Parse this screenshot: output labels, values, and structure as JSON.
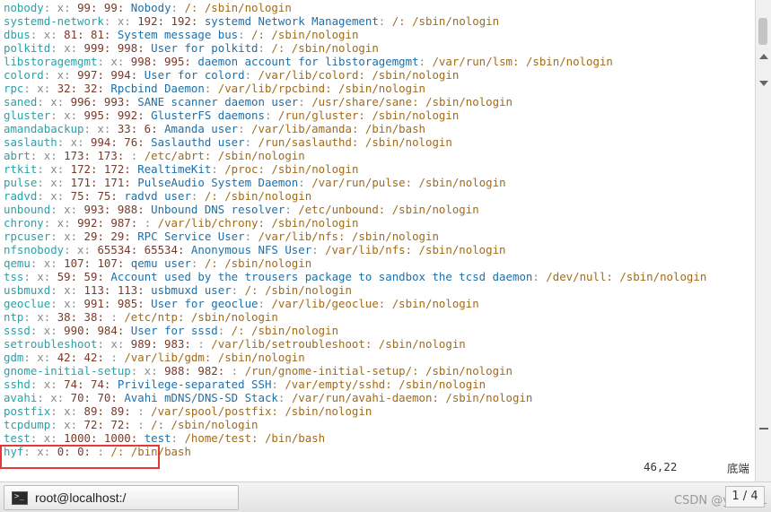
{
  "terminal": {
    "lines": [
      [
        [
          "user",
          "nobody"
        ],
        [
          "sep",
          ": x: "
        ],
        [
          "num",
          "99: 99: "
        ],
        [
          "desc",
          "Nobody"
        ],
        [
          "sep",
          ": "
        ],
        [
          "path",
          "/: /sbin/nologin"
        ]
      ],
      [
        [
          "user",
          "systemd-network"
        ],
        [
          "sep",
          ": x: "
        ],
        [
          "num",
          "192: 192: "
        ],
        [
          "desc",
          "systemd Network Management"
        ],
        [
          "sep",
          ": "
        ],
        [
          "path",
          "/: /sbin/nologin"
        ]
      ],
      [
        [
          "user",
          "dbus"
        ],
        [
          "sep",
          ": x: "
        ],
        [
          "num",
          "81: 81: "
        ],
        [
          "desc",
          "System message bus"
        ],
        [
          "sep",
          ": "
        ],
        [
          "path",
          "/: /sbin/nologin"
        ]
      ],
      [
        [
          "user",
          "polkitd"
        ],
        [
          "sep",
          ": x: "
        ],
        [
          "num",
          "999: 998: "
        ],
        [
          "desc",
          "User for polkitd"
        ],
        [
          "sep",
          ": "
        ],
        [
          "path",
          "/: /sbin/nologin"
        ]
      ],
      [
        [
          "user",
          "libstoragemgmt"
        ],
        [
          "sep",
          ": x: "
        ],
        [
          "num",
          "998: 995: "
        ],
        [
          "desc",
          "daemon account for libstoragemgmt"
        ],
        [
          "sep",
          ": "
        ],
        [
          "path",
          "/var/run/lsm: /sbin/nologin"
        ]
      ],
      [
        [
          "user",
          "colord"
        ],
        [
          "sep",
          ": x: "
        ],
        [
          "num",
          "997: 994: "
        ],
        [
          "desc",
          "User for colord"
        ],
        [
          "sep",
          ": "
        ],
        [
          "path",
          "/var/lib/colord: /sbin/nologin"
        ]
      ],
      [
        [
          "user",
          "rpc"
        ],
        [
          "sep",
          ": x: "
        ],
        [
          "num",
          "32: 32: "
        ],
        [
          "desc",
          "Rpcbind Daemon"
        ],
        [
          "sep",
          ": "
        ],
        [
          "path",
          "/var/lib/rpcbind: /sbin/nologin"
        ]
      ],
      [
        [
          "user",
          "saned"
        ],
        [
          "sep",
          ": x: "
        ],
        [
          "num",
          "996: 993: "
        ],
        [
          "desc",
          "SANE scanner daemon user"
        ],
        [
          "sep",
          ": "
        ],
        [
          "path",
          "/usr/share/sane: /sbin/nologin"
        ]
      ],
      [
        [
          "user",
          "gluster"
        ],
        [
          "sep",
          ": x: "
        ],
        [
          "num",
          "995: 992: "
        ],
        [
          "desc",
          "GlusterFS daemons"
        ],
        [
          "sep",
          ": "
        ],
        [
          "path",
          "/run/gluster: /sbin/nologin"
        ]
      ],
      [
        [
          "user",
          "amandabackup"
        ],
        [
          "sep",
          ": x: "
        ],
        [
          "num",
          "33: 6: "
        ],
        [
          "desc",
          "Amanda user"
        ],
        [
          "sep",
          ": "
        ],
        [
          "path",
          "/var/lib/amanda: /bin/bash"
        ]
      ],
      [
        [
          "user",
          "saslauth"
        ],
        [
          "sep",
          ": x: "
        ],
        [
          "num",
          "994: 76: "
        ],
        [
          "desc",
          "Saslauthd user"
        ],
        [
          "sep",
          ": "
        ],
        [
          "path",
          "/run/saslauthd: /sbin/nologin"
        ]
      ],
      [
        [
          "user",
          "abrt"
        ],
        [
          "sep",
          ": x: "
        ],
        [
          "num",
          "173: 173: "
        ],
        [
          "sep",
          ": "
        ],
        [
          "path",
          "/etc/abrt: /sbin/nologin"
        ]
      ],
      [
        [
          "user",
          "rtkit"
        ],
        [
          "sep",
          ": x: "
        ],
        [
          "num",
          "172: 172: "
        ],
        [
          "desc",
          "RealtimeKit"
        ],
        [
          "sep",
          ": "
        ],
        [
          "path",
          "/proc: /sbin/nologin"
        ]
      ],
      [
        [
          "user",
          "pulse"
        ],
        [
          "sep",
          ": x: "
        ],
        [
          "num",
          "171: 171: "
        ],
        [
          "desc",
          "PulseAudio System Daemon"
        ],
        [
          "sep",
          ": "
        ],
        [
          "path",
          "/var/run/pulse: /sbin/nologin"
        ]
      ],
      [
        [
          "user",
          "radvd"
        ],
        [
          "sep",
          ": x: "
        ],
        [
          "num",
          "75: 75: "
        ],
        [
          "desc",
          "radvd user"
        ],
        [
          "sep",
          ": "
        ],
        [
          "path",
          "/: /sbin/nologin"
        ]
      ],
      [
        [
          "user",
          "unbound"
        ],
        [
          "sep",
          ": x: "
        ],
        [
          "num",
          "993: 988: "
        ],
        [
          "desc",
          "Unbound DNS resolver"
        ],
        [
          "sep",
          ": "
        ],
        [
          "path",
          "/etc/unbound: /sbin/nologin"
        ]
      ],
      [
        [
          "user",
          "chrony"
        ],
        [
          "sep",
          ": x: "
        ],
        [
          "num",
          "992: 987: "
        ],
        [
          "sep",
          ": "
        ],
        [
          "path",
          "/var/lib/chrony: /sbin/nologin"
        ]
      ],
      [
        [
          "user",
          "rpcuser"
        ],
        [
          "sep",
          ": x: "
        ],
        [
          "num",
          "29: 29: "
        ],
        [
          "desc",
          "RPC Service User"
        ],
        [
          "sep",
          ": "
        ],
        [
          "path",
          "/var/lib/nfs: /sbin/nologin"
        ]
      ],
      [
        [
          "user",
          "nfsnobody"
        ],
        [
          "sep",
          ": x: "
        ],
        [
          "num",
          "65534: 65534: "
        ],
        [
          "desc",
          "Anonymous NFS User"
        ],
        [
          "sep",
          ": "
        ],
        [
          "path",
          "/var/lib/nfs: /sbin/nologin"
        ]
      ],
      [
        [
          "user",
          "qemu"
        ],
        [
          "sep",
          ": x: "
        ],
        [
          "num",
          "107: 107: "
        ],
        [
          "desc",
          "qemu user"
        ],
        [
          "sep",
          ": "
        ],
        [
          "path",
          "/: /sbin/nologin"
        ]
      ],
      [
        [
          "user",
          "tss"
        ],
        [
          "sep",
          ": x: "
        ],
        [
          "num",
          "59: 59: "
        ],
        [
          "desc",
          "Account used by the trousers package to sandbox the tcsd daemon"
        ],
        [
          "sep",
          ": "
        ],
        [
          "path",
          "/dev/null: /sbin/nologin"
        ]
      ],
      [
        [
          "user",
          "usbmuxd"
        ],
        [
          "sep",
          ": x: "
        ],
        [
          "num",
          "113: 113: "
        ],
        [
          "desc",
          "usbmuxd user"
        ],
        [
          "sep",
          ": "
        ],
        [
          "path",
          "/: /sbin/nologin"
        ]
      ],
      [
        [
          "user",
          "geoclue"
        ],
        [
          "sep",
          ": x: "
        ],
        [
          "num",
          "991: 985: "
        ],
        [
          "desc",
          "User for geoclue"
        ],
        [
          "sep",
          ": "
        ],
        [
          "path",
          "/var/lib/geoclue: /sbin/nologin"
        ]
      ],
      [
        [
          "user",
          "ntp"
        ],
        [
          "sep",
          ": x: "
        ],
        [
          "num",
          "38: 38: "
        ],
        [
          "sep",
          ": "
        ],
        [
          "path",
          "/etc/ntp: /sbin/nologin"
        ]
      ],
      [
        [
          "user",
          "sssd"
        ],
        [
          "sep",
          ": x: "
        ],
        [
          "num",
          "990: 984: "
        ],
        [
          "desc",
          "User for sssd"
        ],
        [
          "sep",
          ": "
        ],
        [
          "path",
          "/: /sbin/nologin"
        ]
      ],
      [
        [
          "user",
          "setroubleshoot"
        ],
        [
          "sep",
          ": x: "
        ],
        [
          "num",
          "989: 983: "
        ],
        [
          "sep",
          ": "
        ],
        [
          "path",
          "/var/lib/setroubleshoot: /sbin/nologin"
        ]
      ],
      [
        [
          "user",
          "gdm"
        ],
        [
          "sep",
          ": x: "
        ],
        [
          "num",
          "42: 42: "
        ],
        [
          "sep",
          ": "
        ],
        [
          "path",
          "/var/lib/gdm: /sbin/nologin"
        ]
      ],
      [
        [
          "user",
          "gnome-initial-setup"
        ],
        [
          "sep",
          ": x: "
        ],
        [
          "num",
          "988: 982: "
        ],
        [
          "sep",
          ": "
        ],
        [
          "path",
          "/run/gnome-initial-setup/: /sbin/nologin"
        ]
      ],
      [
        [
          "user",
          "sshd"
        ],
        [
          "sep",
          ": x: "
        ],
        [
          "num",
          "74: 74: "
        ],
        [
          "desc",
          "Privilege-separated SSH"
        ],
        [
          "sep",
          ": "
        ],
        [
          "path",
          "/var/empty/sshd: /sbin/nologin"
        ]
      ],
      [
        [
          "user",
          "avahi"
        ],
        [
          "sep",
          ": x: "
        ],
        [
          "num",
          "70: 70: "
        ],
        [
          "desc",
          "Avahi mDNS/DNS-SD Stack"
        ],
        [
          "sep",
          ": "
        ],
        [
          "path",
          "/var/run/avahi-daemon: /sbin/nologin"
        ]
      ],
      [
        [
          "user",
          "postfix"
        ],
        [
          "sep",
          ": x: "
        ],
        [
          "num",
          "89: 89: "
        ],
        [
          "sep",
          ": "
        ],
        [
          "path",
          "/var/spool/postfix: /sbin/nologin"
        ]
      ],
      [
        [
          "user",
          "tcpdump"
        ],
        [
          "sep",
          ": x: "
        ],
        [
          "num",
          "72: 72: "
        ],
        [
          "sep",
          ": "
        ],
        [
          "path",
          "/: /sbin/nologin"
        ]
      ],
      [
        [
          "user",
          "test"
        ],
        [
          "sep",
          ": x: "
        ],
        [
          "num",
          "1000: 1000: "
        ],
        [
          "desc",
          "test"
        ],
        [
          "sep",
          ": "
        ],
        [
          "path",
          "/home/test: /bin/bash"
        ]
      ],
      [
        [
          "user",
          "hyf"
        ],
        [
          "sep",
          ": x: "
        ],
        [
          "num",
          "0: 0: "
        ],
        [
          "sep",
          ": "
        ],
        [
          "path",
          "/: /bin/bash"
        ]
      ]
    ],
    "cursor_position": "46,22",
    "scroll_indicator": "底端"
  },
  "taskbar": {
    "window_label": "root@localhost:/",
    "watermark": "CSDN @yi野艮ㄥ",
    "pager": "1 / 4"
  }
}
